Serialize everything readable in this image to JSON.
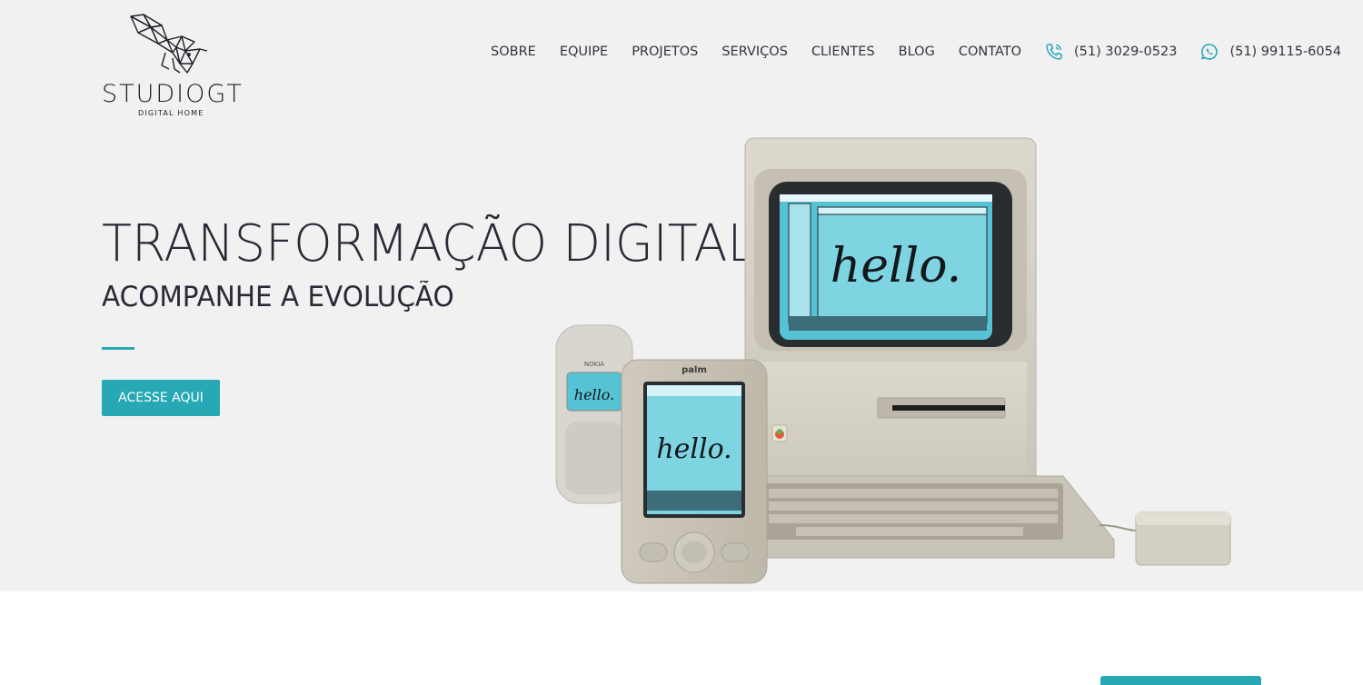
{
  "brand": {
    "name": "STUDIOGT",
    "tagline": "DIGITAL HOME"
  },
  "nav": {
    "items": [
      "SOBRE",
      "EQUIPE",
      "PROJETOS",
      "SERVIÇOS",
      "CLIENTES",
      "BLOG",
      "CONTATO"
    ],
    "phone": "(51) 3029-0523",
    "whatsapp": "(51) 99115-6054"
  },
  "hero": {
    "title": "TRANSFORMAÇÃO DIGITAL",
    "subtitle": "ACOMPANHE A EVOLUÇÃO",
    "cta_label": "ACESSE AQUI",
    "screen_text": "hello.",
    "nokia_brand": "NOKIA",
    "palm_brand": "palm"
  },
  "colors": {
    "accent": "#27a8b5",
    "text": "#2a2a36",
    "hero_bg": "#f1f1f2"
  }
}
